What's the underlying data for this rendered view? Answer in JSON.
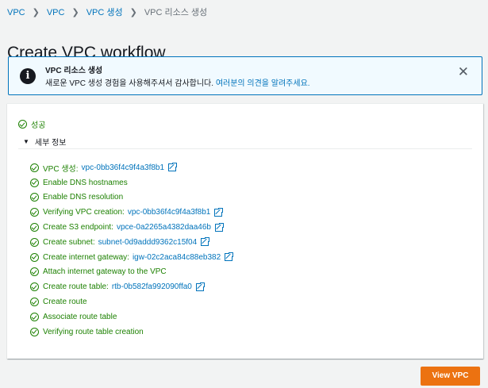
{
  "breadcrumb": [
    {
      "label": "VPC",
      "current": false
    },
    {
      "label": "VPC",
      "current": false
    },
    {
      "label": "VPC 생성",
      "current": false
    },
    {
      "label": "VPC 리소스 생성",
      "current": true
    }
  ],
  "page_title": "Create VPC workflow",
  "flash": {
    "icon": "info-icon",
    "title": "VPC 리소스 생성",
    "message": "새로운 VPC 생성 경험을 사용해주셔서 감사합니다.",
    "link": "여러분의 의견을 알려주세요.",
    "close": "✕"
  },
  "status": {
    "label": "성공",
    "color": "#1d8102"
  },
  "details_label": "세부 정보",
  "steps": [
    {
      "label": "VPC 생성:",
      "resource": "vpc-0bb36f4c9f4a3f8b1"
    },
    {
      "label": "Enable DNS hostnames",
      "resource": ""
    },
    {
      "label": "Enable DNS resolution",
      "resource": ""
    },
    {
      "label": "Verifying VPC creation:",
      "resource": "vpc-0bb36f4c9f4a3f8b1"
    },
    {
      "label": "Create S3 endpoint:",
      "resource": "vpce-0a2265a4382daa46b"
    },
    {
      "label": "Create subnet:",
      "resource": "subnet-0d9addd9362c15f04"
    },
    {
      "label": "Create internet gateway:",
      "resource": "igw-02c2aca84c88eb382"
    },
    {
      "label": "Attach internet gateway to the VPC",
      "resource": ""
    },
    {
      "label": "Create route table:",
      "resource": "rtb-0b582fa992090ffa0"
    },
    {
      "label": "Create route",
      "resource": ""
    },
    {
      "label": "Associate route table",
      "resource": ""
    },
    {
      "label": "Verifying route table creation",
      "resource": ""
    }
  ],
  "view_button": "View VPC",
  "colors": {
    "link": "#0073bb",
    "success": "#1d8102",
    "primary_button": "#ec7211",
    "flash_bg": "#f1faff"
  }
}
